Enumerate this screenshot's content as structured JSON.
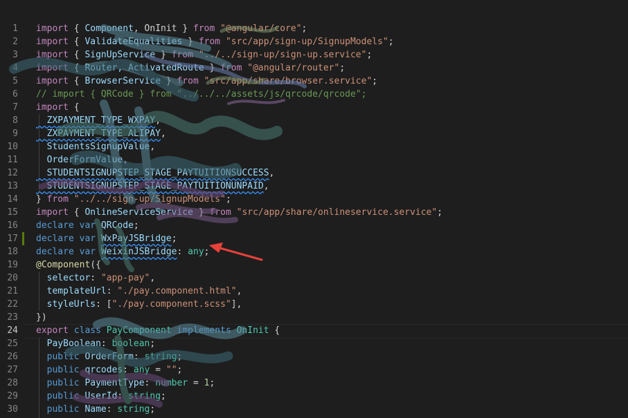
{
  "editor": {
    "line_numbers": [
      "1",
      "2",
      "3",
      "4",
      "5",
      "6",
      "7",
      "8",
      "9",
      "10",
      "11",
      "12",
      "13",
      "14",
      "15",
      "16",
      "17",
      "18",
      "19",
      "20",
      "21",
      "22",
      "23",
      "24",
      "25",
      "26",
      "27",
      "28",
      "29",
      "30"
    ],
    "lines": {
      "l1": {
        "kw": "import",
        "a": " { ",
        "id": "Component",
        "b": ", OnInit } ",
        "kw2": "from",
        "c": " ",
        "str": "\"@angular/core\"",
        "d": ";"
      },
      "l2": {
        "kw": "import",
        "a": " { ",
        "id": "ValidateEqualities",
        "b": " } ",
        "kw2": "from",
        "c": " ",
        "str": "\"src/app/sign-up/SignupModels\"",
        "d": ";"
      },
      "l3": {
        "kw": "import",
        "a": " { ",
        "id": "SignUpService",
        "b": " } ",
        "kw2": "from",
        "c": " ",
        "str": "\"../../sign-up/sign-up.service\"",
        "d": ";"
      },
      "l4": {
        "kw": "import",
        "a": " { ",
        "id": "Router, ActivatedRoute",
        "b": " } ",
        "kw2": "from",
        "c": " ",
        "str": "\"@angular/router\"",
        "d": ";"
      },
      "l5": {
        "kw": "import",
        "a": " { ",
        "id": "BrowserService",
        "b": " } ",
        "kw2": "from",
        "c": " ",
        "str": "\"src/app/share/browser.service\"",
        "d": ";"
      },
      "l6": {
        "cmt": "// import { QRCode } from \"../../../assets/js/qrcode/qrcode\";"
      },
      "l7": {
        "kw": "import",
        "a": " {"
      },
      "l8": {
        "id": "  ZXPAYMENT_TYPE_WXPAY",
        "d": ","
      },
      "l9": {
        "id": "  ZXPAYMENT_TYPE_ALIPAY",
        "d": ","
      },
      "l10": {
        "id": "  StudentsSignupValue",
        "d": ","
      },
      "l11": {
        "id": "  OrderFormValue",
        "d": ","
      },
      "l12": {
        "id": "  STUDENTSIGNUPSTEP_STAGE_PAYTUITIONSUCCESS",
        "d": ","
      },
      "l13": {
        "id": "  STUDENTSIGNUPSTEP_STAGE_PAYTUITIONUNPAID",
        "d": ","
      },
      "l14": {
        "a": "} ",
        "kw2": "from",
        "c": " ",
        "str": "\"../../sign-up/SignupModels\"",
        "d": ";"
      },
      "l15": {
        "kw": "import",
        "a": " { ",
        "id": "OnlineServiceService",
        "b": " } ",
        "kw2": "from",
        "c": " ",
        "str": "\"src/app/share/onlineservice.service\"",
        "d": ";"
      },
      "l16": {
        "kw": "declare",
        "a": " ",
        "kw3": "var",
        "b": " ",
        "id": "QRCode",
        "d": ";"
      },
      "l17": {
        "kw": "declare",
        "a": " ",
        "kw3": "var",
        "b": " ",
        "id": "WxPayJSBridge",
        "d": ";"
      },
      "l18": {
        "kw": "declare",
        "a": " ",
        "kw3": "var",
        "b": " ",
        "id": "WeixinJSBridge",
        "c": ": ",
        "type": "any",
        "d": ";"
      },
      "l19": {
        "dec": "@Component",
        "a": "({"
      },
      "l20": {
        "id": "  selector",
        "a": ": ",
        "str": "\"app-pay\"",
        "d": ","
      },
      "l21": {
        "id": "  templateUrl",
        "a": ": ",
        "str": "\"./pay.component.html\"",
        "d": ","
      },
      "l22": {
        "id": "  styleUrls",
        "a": ": [",
        "str": "\"./pay.component.scss\"",
        "d": "],"
      },
      "l23": {
        "a": "})"
      },
      "l24": {
        "kw": "export",
        "a": " ",
        "kw3": "class",
        "b": " ",
        "cls": "PayComponent",
        "c": " ",
        "kw4": "implements",
        "e": " ",
        "cls2": "OnInit",
        "d": " {"
      },
      "l25": {
        "id": "  PayBoolean",
        "a": ": ",
        "type": "boolean",
        "d": ";"
      },
      "l26": {
        "kw": "  public",
        "a": " ",
        "id": "OrderForm",
        "b": ": ",
        "type": "string",
        "d": ";"
      },
      "l27": {
        "kw": "  public",
        "a": " ",
        "id": "qrcodes",
        "b": ": ",
        "type": "any",
        "c": " = ",
        "str": "\"\"",
        "d": ";"
      },
      "l28": {
        "kw": "  public",
        "a": " ",
        "id": "PaymentType",
        "b": ": ",
        "type": "number",
        "c": " = ",
        "num": "1",
        "d": ";"
      },
      "l29": {
        "kw": "  public",
        "a": " ",
        "id": "UserId",
        "b": ": ",
        "type": "string",
        "d": ";"
      },
      "l30": {
        "kw": "  public",
        "a": " ",
        "id": "Name",
        "b": ": ",
        "type": "string",
        "d": ";"
      }
    }
  },
  "colors": {
    "background": "#1e1e1e",
    "arrow": "#e8413a"
  }
}
